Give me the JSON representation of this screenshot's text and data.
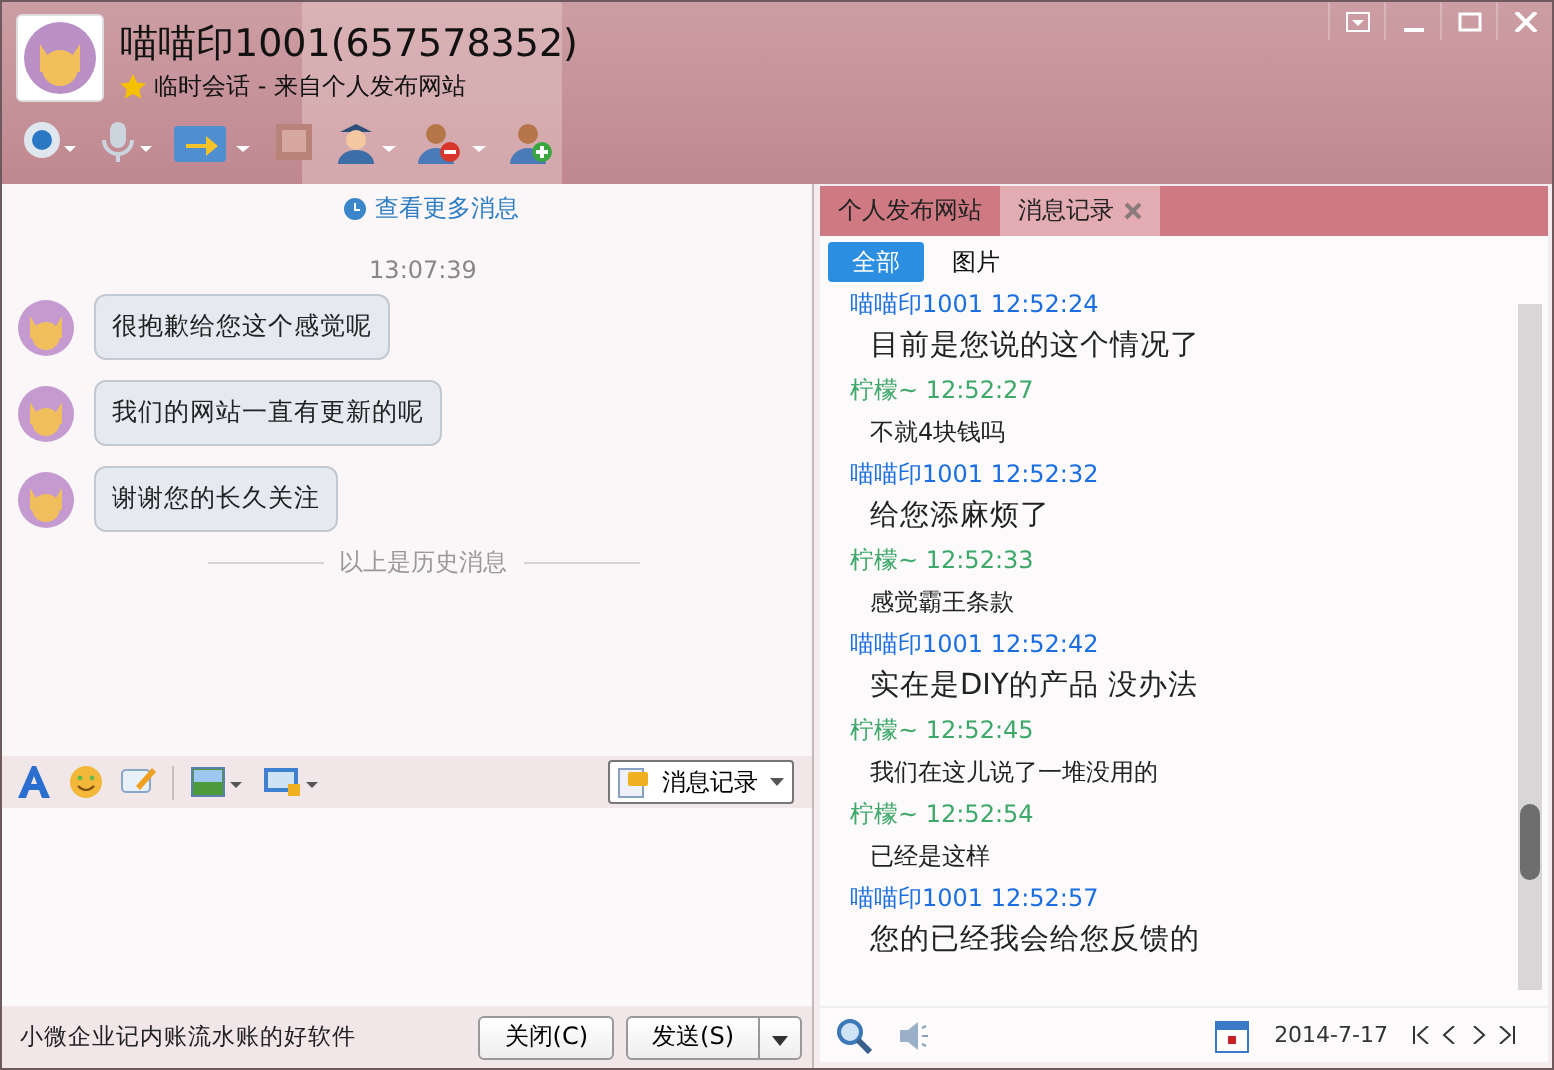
{
  "window": {
    "title": "喵喵印1001(657578352)",
    "subtitle": "临时会话 - 来自个人发布网站"
  },
  "chat": {
    "more_link": "查看更多消息",
    "time": "13:07:39",
    "messages": [
      {
        "text": "很抱歉给您这个感觉呢"
      },
      {
        "text": "我们的网站一直有更新的呢"
      },
      {
        "text": "谢谢您的长久关注"
      }
    ],
    "history_divider": "以上是历史消息"
  },
  "input_toolbar": {
    "history_button": "消息记录"
  },
  "footer": {
    "ad": "小微企业记内账流水账的好软件",
    "close_button": "关闭(C)",
    "send_button": "发送(S)"
  },
  "side": {
    "tabs": [
      {
        "label": "个人发布网站",
        "selected": false,
        "closable": false
      },
      {
        "label": "消息记录",
        "selected": true,
        "closable": true
      }
    ],
    "filters": [
      {
        "label": "全部",
        "selected": true
      },
      {
        "label": "图片",
        "selected": false
      }
    ],
    "entries": [
      {
        "kind": "me",
        "sender": "喵喵印1001",
        "time": "12:52:24",
        "text": "目前是您说的这个情况了"
      },
      {
        "kind": "other",
        "sender": "柠檬~",
        "time": "12:52:27",
        "text": "不就4块钱吗"
      },
      {
        "kind": "me",
        "sender": "喵喵印1001",
        "time": "12:52:32",
        "text": "给您添麻烦了"
      },
      {
        "kind": "other",
        "sender": "柠檬~",
        "time": "12:52:33",
        "text": "感觉霸王条款"
      },
      {
        "kind": "me",
        "sender": "喵喵印1001",
        "time": "12:52:42",
        "text": "实在是DIY的产品 没办法"
      },
      {
        "kind": "other",
        "sender": "柠檬~",
        "time": "12:52:45",
        "text": "我们在这儿说了一堆没用的"
      },
      {
        "kind": "other",
        "sender": "柠檬~",
        "time": "12:52:54",
        "text": "已经是这样"
      },
      {
        "kind": "me",
        "sender": "喵喵印1001",
        "time": "12:52:57",
        "text": "您的已经我会给您反馈的"
      }
    ],
    "date": "2014-7-17"
  }
}
